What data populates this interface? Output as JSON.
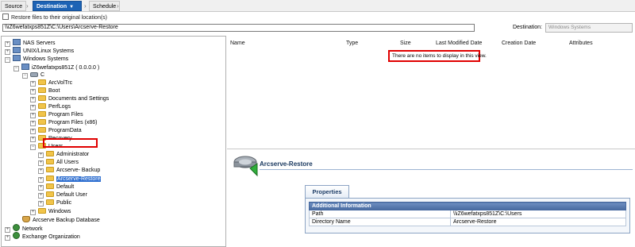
{
  "tabs": {
    "source": "Source",
    "destination": "Destination",
    "schedule": "Schedule"
  },
  "restore_checkbox_label": "Restore files to their original location(s)",
  "path_value": "\\\\iZ6wefatxps851Z\\C:\\Users\\Arcserve-Restore",
  "destination": {
    "label": "Destination:",
    "value": "Windows Systems"
  },
  "tree": {
    "nas": "NAS Servers",
    "unix": "UNIX/Linux Systems",
    "windows": "Windows Systems",
    "host": "iZ6wefatxps851Z ( 0.0.0.0 )",
    "drive": "C",
    "arcvol": "ArcVolTrc",
    "boot": "Boot",
    "docs": "Documents and Settings",
    "perflogs": "PerfLogs",
    "progfiles": "Program Files",
    "progfiles86": "Program Files (x86)",
    "progdata": "ProgramData",
    "recovery": "Recovery",
    "users": "Users",
    "admin": "Administrator",
    "allusers": "All Users",
    "arcbackup": "Arcserve- Backup",
    "arcrestore": "Arcserve-Restore",
    "default": "Default",
    "defaultuser": "Default User",
    "public": "Public",
    "windowsdir": "Windows",
    "arcdb": "Arcserve Backup Database",
    "network": "Network",
    "exchange": "Exchange Organization"
  },
  "list": {
    "columns": {
      "name": "Name",
      "type": "Type",
      "size": "Size",
      "modified": "Last Modified Date",
      "created": "Creation Date",
      "attributes": "Attributes"
    },
    "empty_message": "There are no items to display in this view."
  },
  "properties": {
    "title": "Arcserve-Restore",
    "tab": "Properties",
    "section": "Additional Information",
    "rows": [
      {
        "label": "Path",
        "value": "\\\\iZ6wefatxps851Z\\C:\\Users"
      },
      {
        "label": "Directory Name",
        "value": "Arcserve-Restore"
      }
    ]
  },
  "colors": {
    "accent": "#1d63b5",
    "highlight": "#e00000",
    "selection": "#2f6fd0"
  }
}
